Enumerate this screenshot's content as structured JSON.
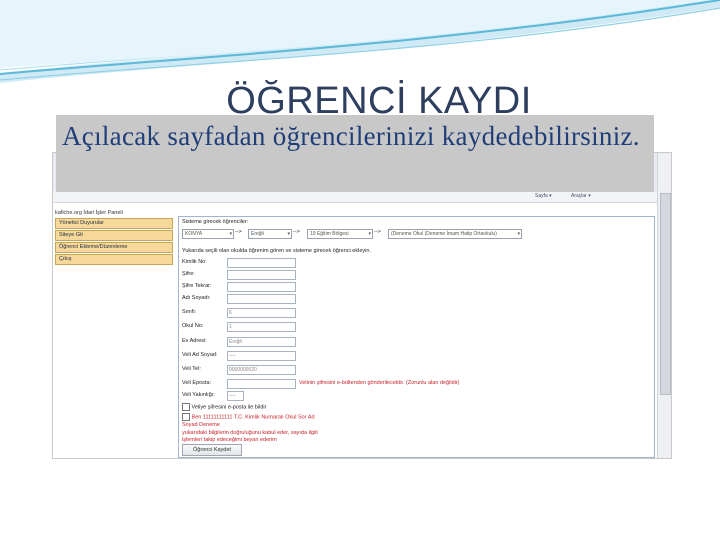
{
  "slide": {
    "title": "ÖĞRENCİ KAYDI",
    "caption": "Açılacak sayfadan öğrencilerinizi kaydedebilirsiniz."
  },
  "colors": {
    "title": "#2d3e5e",
    "caption_text": "#1f3e78",
    "caption_bg": "#c8c8c8",
    "swoosh": "#5bb8d8",
    "sidebar_item_bg": "#f6d89a",
    "warning_text": "#c8222a"
  },
  "screenshot": {
    "toolbar_items": [
      "Sayfa ▾",
      "Araçlar ▾"
    ],
    "sidebar": {
      "title": "kafiche.org İdari İşler Paneli",
      "items": [
        "Yönetici Duyurular",
        "Siteye Git",
        "Öğrenci Ekleme/Düzenleme",
        "Çıkış"
      ]
    },
    "form": {
      "section_title": "Sisteme girecek öğrenciler:",
      "selects": [
        {
          "value": "KONYA",
          "sep": "-->"
        },
        {
          "value": "Ereğli",
          "sep": "-->"
        },
        {
          "value": "19 Eğitim Bölgesi",
          "sep": "-->"
        },
        {
          "value": "(Deneme Okul (Deneme İmam Hatip Ortaokulu)",
          "sep": ""
        }
      ],
      "instruction": "Yukarıda seçili olan okulda öğrenim gören ve sisteme girecek öğrenci ekleyin.",
      "fields": [
        {
          "label": "Kimlik No:",
          "value": ""
        },
        {
          "label": "Şifre:",
          "value": ""
        },
        {
          "label": "Şifre Tekrar:",
          "value": ""
        },
        {
          "label": "Adı Soyadı:",
          "value": ""
        },
        {
          "label": "Sınıfı:",
          "value": "6"
        },
        {
          "label": "Okul No:",
          "value": "1"
        },
        {
          "label": "Ev Adresi:",
          "value": "Ereğli"
        },
        {
          "label": "Veli Ad Soyad:",
          "value": "----"
        },
        {
          "label": "Veli Tel:",
          "value": "0000000020"
        },
        {
          "label": "Veli Eposta:",
          "value": ""
        },
        {
          "label": "Veli Yakınlığı:",
          "value": "----"
        }
      ],
      "email_warning": "Velinin şifresini e-bültenden gönderilecektir. (Zorunlu alan değildir)",
      "checkbox1": "Veliye şifresini e-posta ile bildir",
      "checkbox2_line1": "Ben 11111111111 T.C. Kimlik Numaralı Okul Sor Ad",
      "checkbox2_line2": "Soyad Deneme",
      "consent_line1": "yukarıdaki bilgilerin doğruluğunu kabul eder, sayıda ilgili",
      "consent_line2": "işlemleri takip edeceğimi beyan ederim",
      "submit": "Öğrenci Kaydet"
    }
  }
}
